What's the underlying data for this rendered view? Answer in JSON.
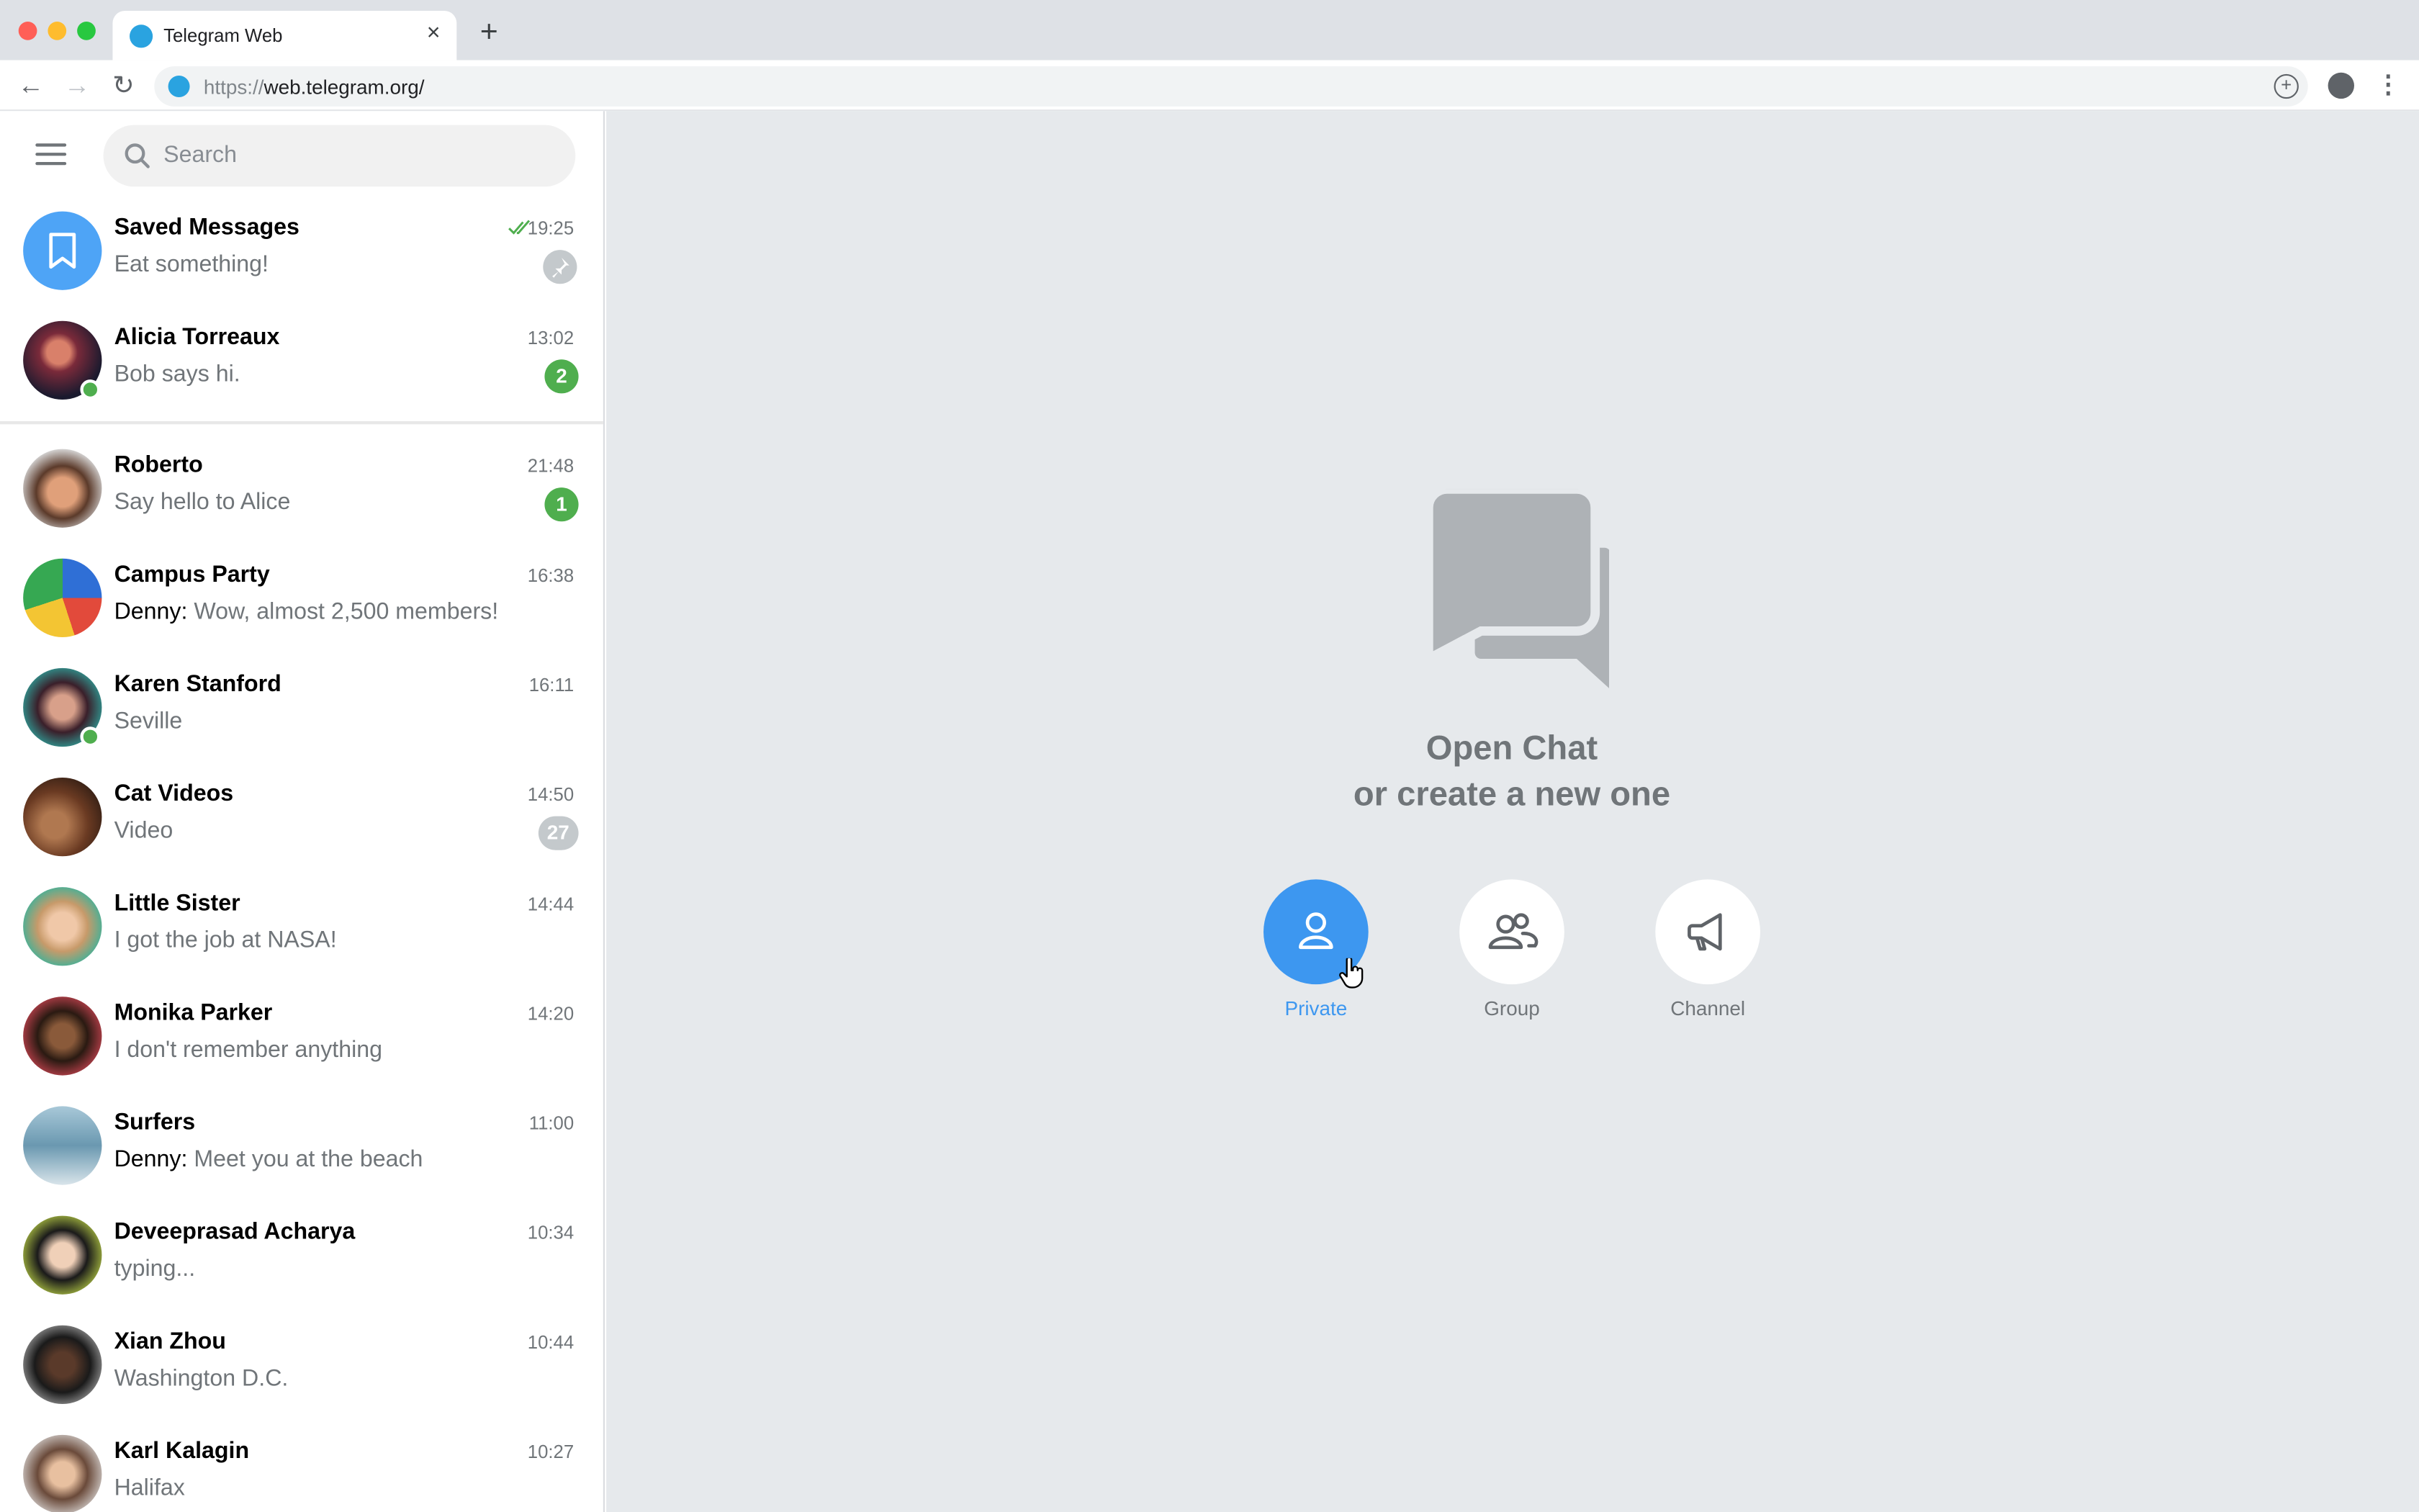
{
  "browser": {
    "tab_title": "Telegram Web",
    "tab_close": "×",
    "new_tab": "+",
    "url_scheme": "https://",
    "url_host": "web.telegram.org/",
    "back": "←",
    "forward": "→",
    "reload": "↻",
    "kebab": "⋮"
  },
  "sidebar": {
    "search_placeholder": "Search",
    "chats": [
      {
        "name": "Saved Messages",
        "time": "19:25",
        "message": "Eat something!",
        "sender": "",
        "badge": "",
        "pinned": true,
        "read": true
      },
      {
        "name": "Alicia Torreaux",
        "time": "13:02",
        "message": "Bob says hi.",
        "sender": "",
        "badge": "2",
        "online": true
      },
      {
        "name": "Roberto",
        "time": "21:48",
        "message": "Say hello to Alice",
        "sender": "",
        "badge": "1"
      },
      {
        "name": "Campus Party",
        "time": "16:38",
        "message": "Wow, almost 2,500 members!",
        "sender": "Denny: ",
        "badge": ""
      },
      {
        "name": "Karen Stanford",
        "time": "16:11",
        "message": "Seville",
        "sender": "",
        "badge": "",
        "online": true
      },
      {
        "name": "Cat Videos",
        "time": "14:50",
        "message": "Video",
        "sender": "",
        "badge": "27",
        "muted": true
      },
      {
        "name": "Little Sister",
        "time": "14:44",
        "message": "I got the job at NASA!",
        "sender": "",
        "badge": ""
      },
      {
        "name": "Monika Parker",
        "time": "14:20",
        "message": "I don't remember anything",
        "sender": "",
        "badge": ""
      },
      {
        "name": "Surfers",
        "time": "11:00",
        "message": "Meet you at the beach",
        "sender": "Denny: ",
        "badge": ""
      },
      {
        "name": "Deveeprasad Acharya",
        "time": "10:34",
        "message": "typing...",
        "sender": "",
        "badge": ""
      },
      {
        "name": "Xian Zhou",
        "time": "10:44",
        "message": "Washington D.C.",
        "sender": "",
        "badge": ""
      },
      {
        "name": "Karl Kalagin",
        "time": "10:27",
        "message": "Halifax",
        "sender": "",
        "badge": ""
      }
    ]
  },
  "main": {
    "title_line1": "Open Chat",
    "title_line2": "or create a new one",
    "actions": [
      {
        "label": "Private",
        "icon": "person-icon"
      },
      {
        "label": "Group",
        "icon": "group-icon"
      },
      {
        "label": "Channel",
        "icon": "megaphone-icon"
      }
    ]
  },
  "colors": {
    "accent": "#3d97f0",
    "badge_green": "#4fae4e",
    "badge_muted": "#c4c9cc",
    "secondary_text": "#707579",
    "main_bg": "#e6e9ec",
    "saved_avatar": "#4ea4f6"
  }
}
